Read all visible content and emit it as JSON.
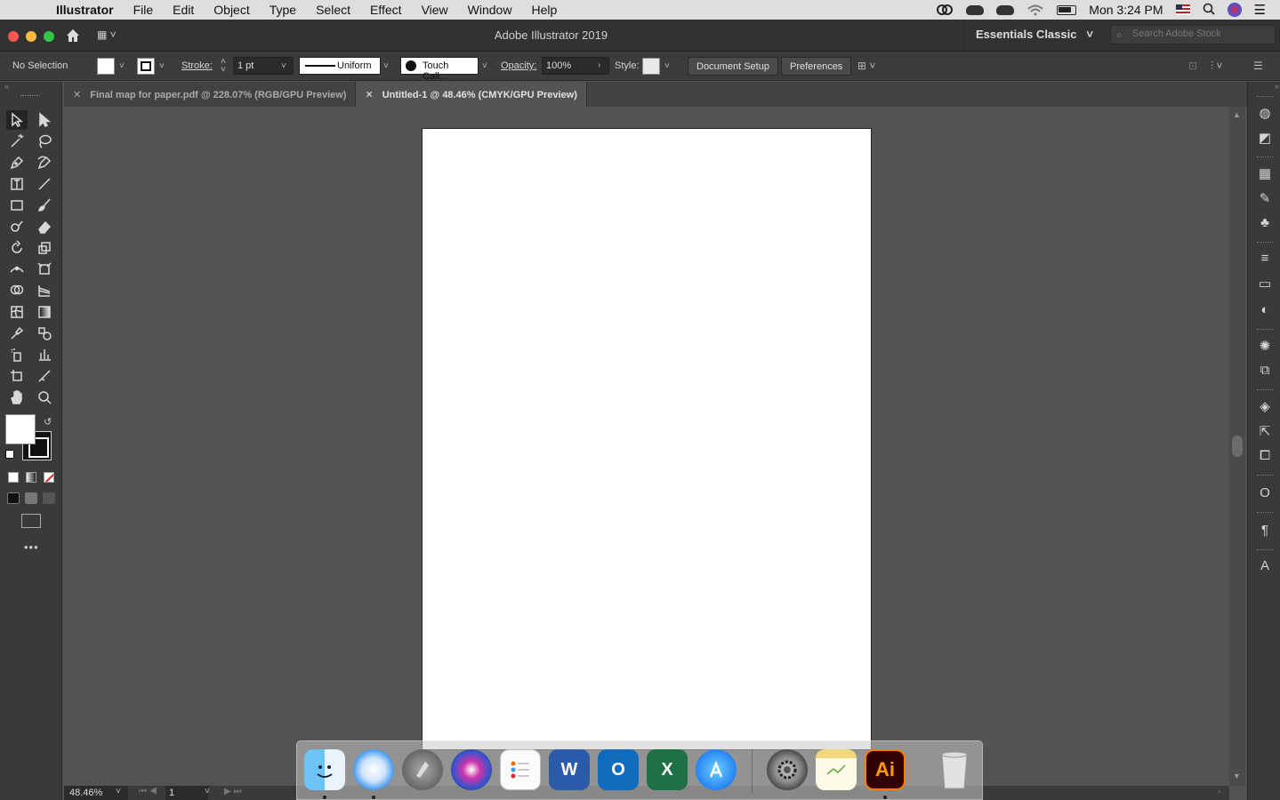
{
  "menubar": {
    "app_name": "Illustrator",
    "items": [
      "File",
      "Edit",
      "Object",
      "Type",
      "Select",
      "Effect",
      "View",
      "Window",
      "Help"
    ],
    "clock": "Mon 3:24 PM"
  },
  "window": {
    "title": "Adobe Illustrator 2019",
    "workspace": "Essentials Classic",
    "search_placeholder": "Search Adobe Stock"
  },
  "controlbar": {
    "selection": "No Selection",
    "stroke_label": "Stroke:",
    "stroke_weight": "1 pt",
    "profile": "Uniform",
    "brush": "Touch Call...",
    "opacity_label": "Opacity:",
    "opacity": "100%",
    "style_label": "Style:",
    "document_setup": "Document Setup",
    "preferences": "Preferences"
  },
  "tabs": [
    {
      "label": "Final map for paper.pdf @ 228.07% (RGB/GPU Preview)",
      "active": false
    },
    {
      "label": "Untitled-1 @ 48.46% (CMYK/GPU Preview)",
      "active": true
    }
  ],
  "statusbar": {
    "zoom": "48.46%",
    "page": "1"
  },
  "colors": {
    "ui_background": "#535353",
    "panel": "#3a3a3a",
    "artboard": "#ffffff",
    "fill": "#ffffff",
    "stroke": "#111111"
  },
  "toolbar_icons": [
    "selection-tool",
    "direct-selection-tool",
    "magic-wand-tool",
    "lasso-tool",
    "pen-tool",
    "curvature-tool",
    "type-tool",
    "line-tool",
    "rectangle-tool",
    "paintbrush-tool",
    "shaper-tool",
    "eraser-tool",
    "rotate-tool",
    "scale-tool",
    "width-tool",
    "free-transform-tool",
    "shape-builder-tool",
    "perspective-grid-tool",
    "mesh-tool",
    "gradient-tool",
    "eyedropper-tool",
    "blend-tool",
    "symbol-sprayer-tool",
    "column-graph-tool",
    "artboard-tool",
    "slice-tool",
    "hand-tool",
    "zoom-tool"
  ],
  "dock_apps": [
    "Finder",
    "Safari",
    "Launchpad",
    "Siri",
    "Reminders",
    "Microsoft Word",
    "Microsoft Outlook",
    "Microsoft Excel",
    "App Store",
    "System Preferences",
    "Notes",
    "Adobe Illustrator",
    "Trash"
  ]
}
